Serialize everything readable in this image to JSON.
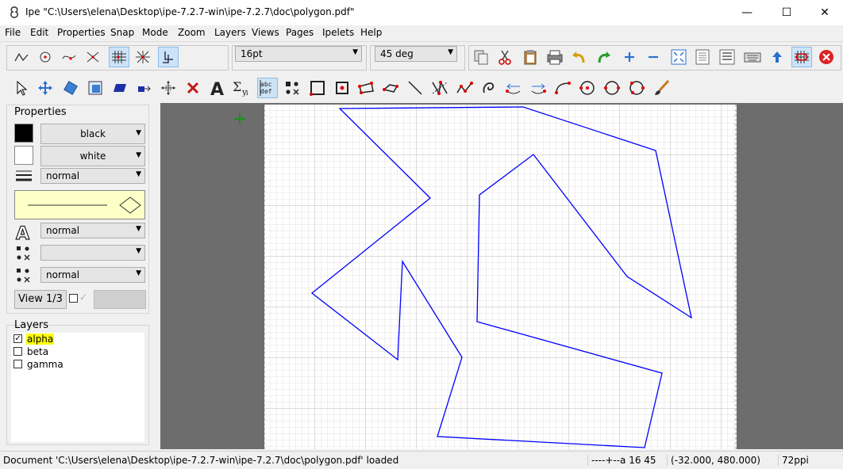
{
  "window": {
    "title": "Ipe \"C:\\Users\\elena\\Desktop\\ipe-7.2.7-win\\ipe-7.2.7\\doc\\polygon.pdf\"",
    "minimize": "—",
    "maximize": "☐",
    "close": "✕"
  },
  "menu": [
    "File",
    "Edit",
    "Properties",
    "Snap",
    "Mode",
    "Zoom",
    "Layers",
    "Views",
    "Pages",
    "Ipelets",
    "Help"
  ],
  "toolbar": {
    "pen_size": "16pt",
    "angle": "45 deg"
  },
  "properties": {
    "title": "Properties",
    "stroke_color": "black",
    "fill_color": "white",
    "pen_width": "normal",
    "text_size": "normal",
    "mark_shape": "",
    "mark_size": "normal",
    "view_button": "View 1/3"
  },
  "layers": {
    "title": "Layers",
    "items": [
      {
        "name": "alpha",
        "checked": true,
        "active": true
      },
      {
        "name": "beta",
        "checked": false,
        "active": false
      },
      {
        "name": "gamma",
        "checked": false,
        "active": false
      }
    ]
  },
  "status": {
    "message": "Document 'C:\\Users\\elena\\Desktop\\ipe-7.2.7-win\\ipe-7.2.7\\doc\\polygon.pdf' loaded",
    "snap": "----+--a 16 45",
    "coords": "(-32.000, 480.000)",
    "resolution": "72ppi"
  },
  "colors": {
    "polygon_stroke": "#0000ff",
    "active_layer": "#ffff00",
    "grid": "#d7d7d7"
  }
}
